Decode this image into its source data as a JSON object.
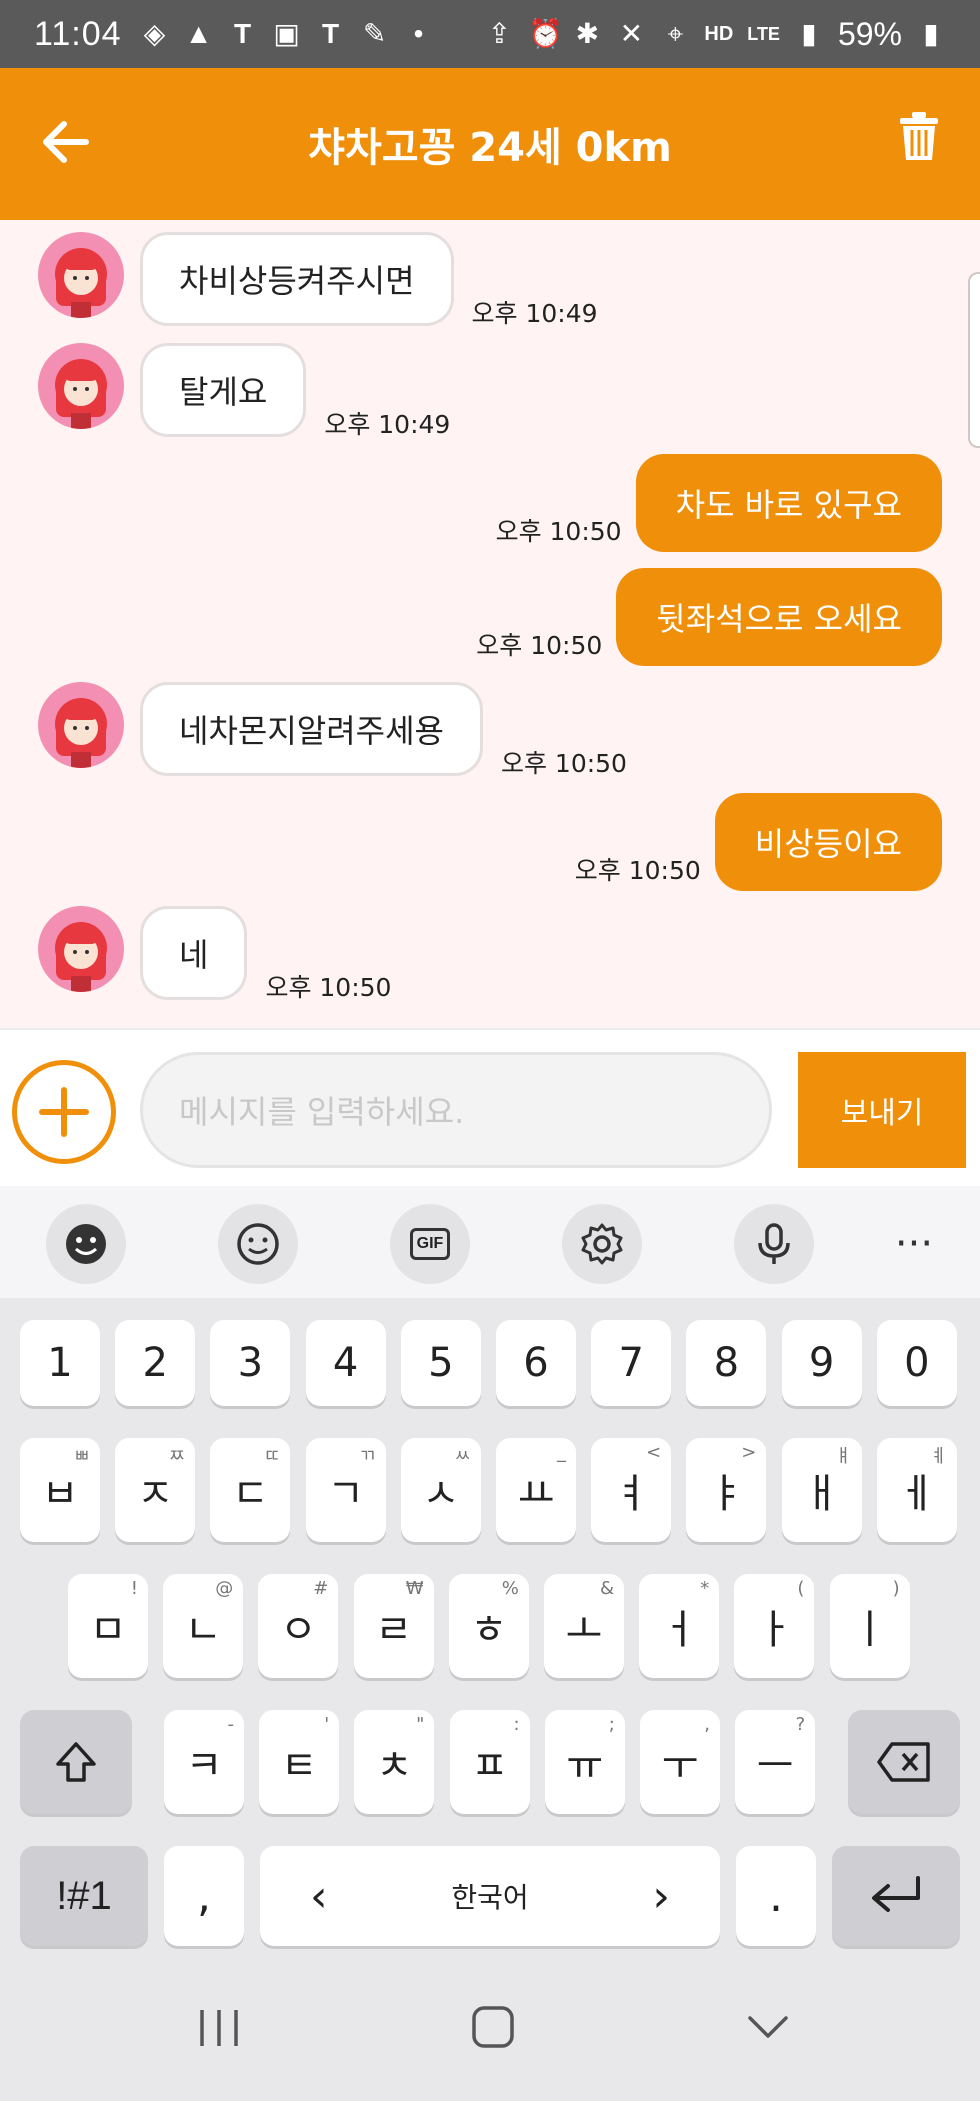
{
  "status_bar": {
    "time": "11:04",
    "battery": "59%",
    "hd_label": "HD",
    "lte_label": "LTE"
  },
  "app_bar": {
    "title": "챠차고꽁 24세 0km"
  },
  "messages": [
    {
      "dir": "in",
      "text": "차비상등켜주시면",
      "time": "오후 10:49"
    },
    {
      "dir": "in",
      "text": "탈게요",
      "time": "오후 10:49"
    },
    {
      "dir": "out",
      "text": "차도 바로 있구요",
      "time": "오후 10:50"
    },
    {
      "dir": "out",
      "text": "뒷좌석으로 오세요",
      "time": "오후 10:50"
    },
    {
      "dir": "in",
      "text": "네차몬지알려주세용",
      "time": "오후 10:50"
    },
    {
      "dir": "out",
      "text": "비상등이요",
      "time": "오후 10:50"
    },
    {
      "dir": "in",
      "text": "네",
      "time": "오후 10:50"
    }
  ],
  "input": {
    "placeholder": "메시지를 입력하세요.",
    "send_label": "보내기"
  },
  "keyboard": {
    "toolbar": [
      "emoji-sticker-icon",
      "emoji-icon",
      "gif-icon",
      "settings-icon",
      "mic-icon",
      "more-icon"
    ],
    "gif_label": "GIF",
    "more_label": "···",
    "row_numbers": [
      "1",
      "2",
      "3",
      "4",
      "5",
      "6",
      "7",
      "8",
      "9",
      "0"
    ],
    "row1": [
      {
        "k": "ㅂ",
        "h": "ㅃ"
      },
      {
        "k": "ㅈ",
        "h": "ㅉ"
      },
      {
        "k": "ㄷ",
        "h": "ㄸ"
      },
      {
        "k": "ㄱ",
        "h": "ㄲ"
      },
      {
        "k": "ㅅ",
        "h": "ㅆ"
      },
      {
        "k": "ㅛ",
        "h": "_"
      },
      {
        "k": "ㅕ",
        "h": "<"
      },
      {
        "k": "ㅑ",
        "h": ">"
      },
      {
        "k": "ㅐ",
        "h": "ㅒ"
      },
      {
        "k": "ㅔ",
        "h": "ㅖ"
      }
    ],
    "row2": [
      {
        "k": "ㅁ",
        "h": "!"
      },
      {
        "k": "ㄴ",
        "h": "@"
      },
      {
        "k": "ㅇ",
        "h": "#"
      },
      {
        "k": "ㄹ",
        "h": "₩"
      },
      {
        "k": "ㅎ",
        "h": "%"
      },
      {
        "k": "ㅗ",
        "h": "&"
      },
      {
        "k": "ㅓ",
        "h": "*"
      },
      {
        "k": "ㅏ",
        "h": "("
      },
      {
        "k": "ㅣ",
        "h": ")"
      }
    ],
    "row3": [
      {
        "k": "ㅋ",
        "h": "-"
      },
      {
        "k": "ㅌ",
        "h": "'"
      },
      {
        "k": "ㅊ",
        "h": "\""
      },
      {
        "k": "ㅍ",
        "h": ":"
      },
      {
        "k": "ㅠ",
        "h": ";"
      },
      {
        "k": "ㅜ",
        "h": ","
      },
      {
        "k": "ㅡ",
        "h": "?"
      }
    ],
    "symbols_label": "!#1",
    "comma_label": ",",
    "space_label": "한국어",
    "space_left": "‹",
    "space_right": "›",
    "period_label": "."
  },
  "colors": {
    "accent": "#f0900a",
    "chat_bg": "#fff3f3"
  }
}
